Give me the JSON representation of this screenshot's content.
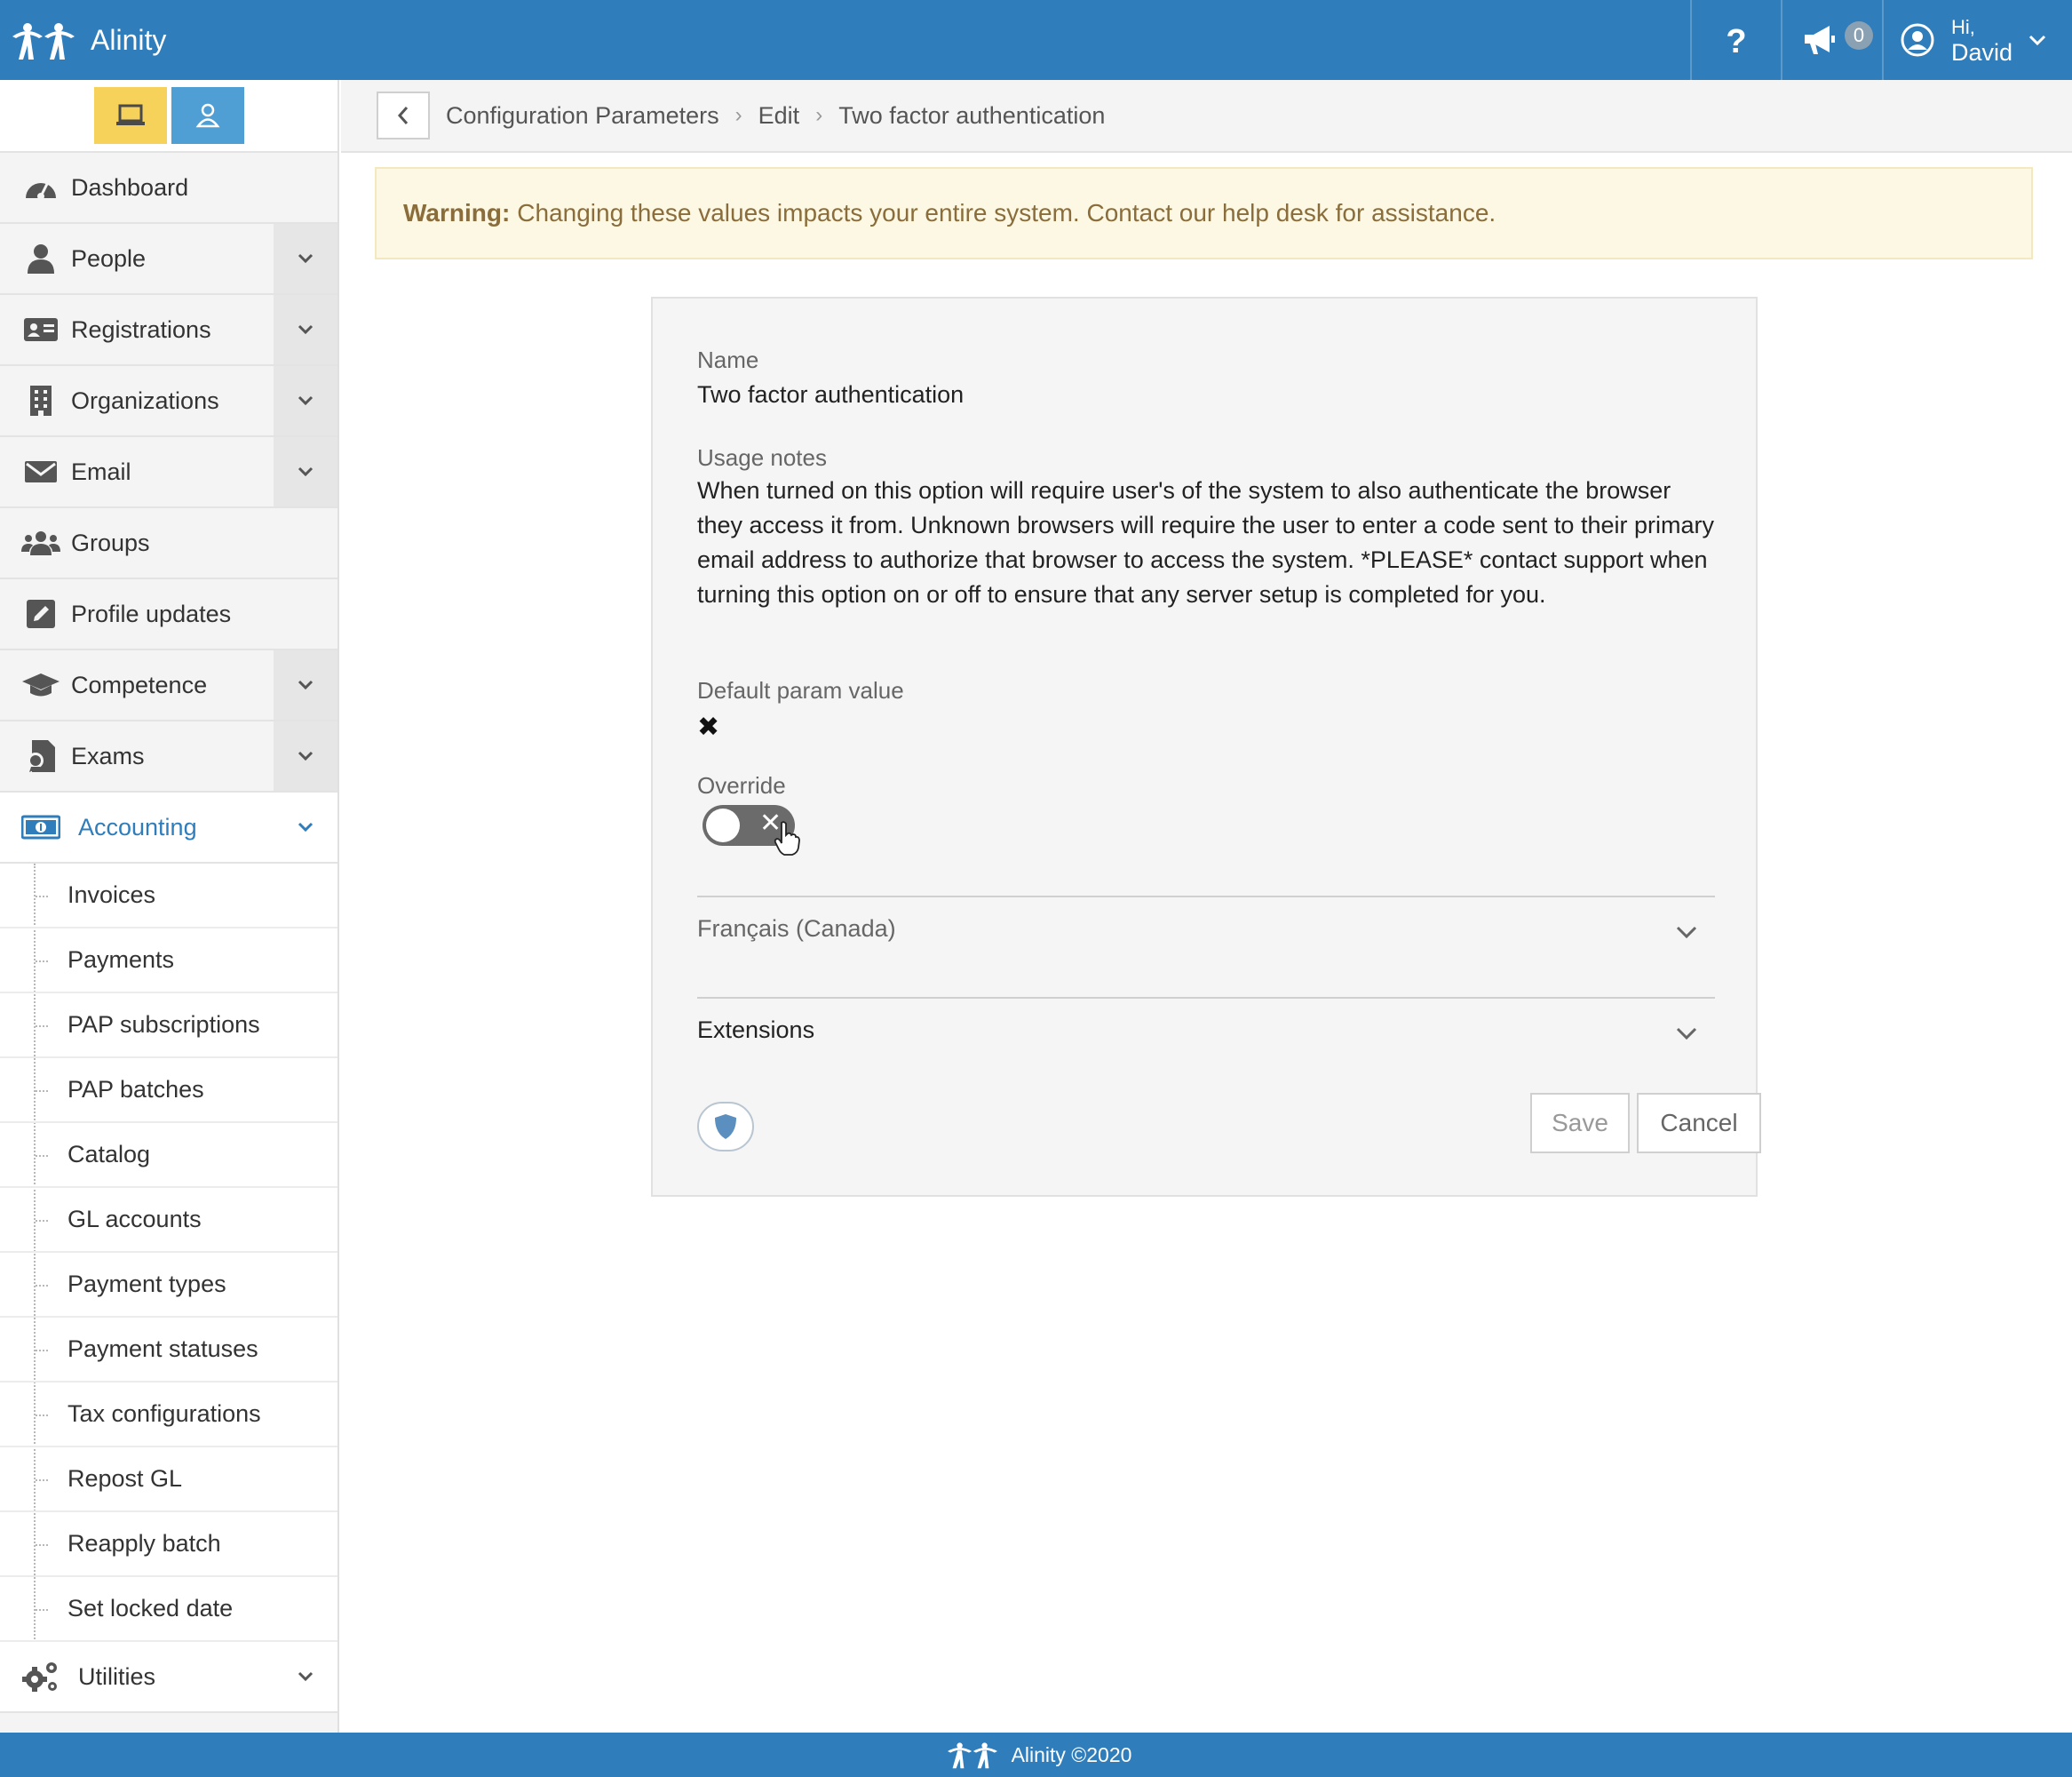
{
  "app": {
    "name": "Alinity"
  },
  "topbar": {
    "help_icon": "question-icon",
    "notifications_count": "0",
    "user_greeting": "Hi,",
    "user_name": "David"
  },
  "sidebar": {
    "mode_buttons": [
      "laptop-icon",
      "user-icon"
    ],
    "items": [
      {
        "label": "Dashboard",
        "icon": "dashboard-icon"
      },
      {
        "label": "People",
        "icon": "person-icon"
      },
      {
        "label": "Registrations",
        "icon": "id-card-icon"
      },
      {
        "label": "Organizations",
        "icon": "building-icon"
      },
      {
        "label": "Email",
        "icon": "envelope-icon"
      },
      {
        "label": "Groups",
        "icon": "users-icon"
      },
      {
        "label": "Profile updates",
        "icon": "edit-icon"
      },
      {
        "label": "Competence",
        "icon": "graduation-cap-icon"
      },
      {
        "label": "Exams",
        "icon": "exam-icon"
      },
      {
        "label": "Accounting",
        "icon": "money-icon"
      }
    ],
    "accounting_sub": [
      "Invoices",
      "Payments",
      "PAP subscriptions",
      "PAP batches",
      "Catalog",
      "GL accounts",
      "Payment types",
      "Payment statuses",
      "Tax configurations",
      "Repost GL",
      "Reapply batch",
      "Set locked date"
    ],
    "utilities": {
      "label": "Utilities",
      "icon": "cogs-icon"
    }
  },
  "breadcrumb": {
    "items": [
      "Configuration Parameters",
      "Edit",
      "Two factor authentication"
    ]
  },
  "warning": {
    "prefix": "Warning:",
    "text": "Changing these values impacts your entire system. Contact our help desk for assistance."
  },
  "form": {
    "name_label": "Name",
    "name_value": "Two factor authentication",
    "usage_label": "Usage notes",
    "usage_value": "When turned on this option will require user's of the system to also authenticate the browser they access it from. Unknown browsers will require the user to enter a code sent to their primary email address to authorize that browser to access the system. *PLEASE* contact support when turning this option on or off to ensure that any server setup is completed for you.",
    "default_label": "Default param value",
    "default_value": "✖",
    "override_label": "Override",
    "override_on": false,
    "sections": [
      "Français (Canada)",
      "Extensions"
    ],
    "save_label": "Save",
    "cancel_label": "Cancel"
  },
  "footer": {
    "text": "Alinity ©2020"
  },
  "colors": {
    "primary": "#2f7dbb",
    "warning_bg": "#fcf8e3",
    "warning_text": "#8a6d3b",
    "mode_admin": "#f6d25a",
    "mode_user": "#4f9fd4"
  }
}
